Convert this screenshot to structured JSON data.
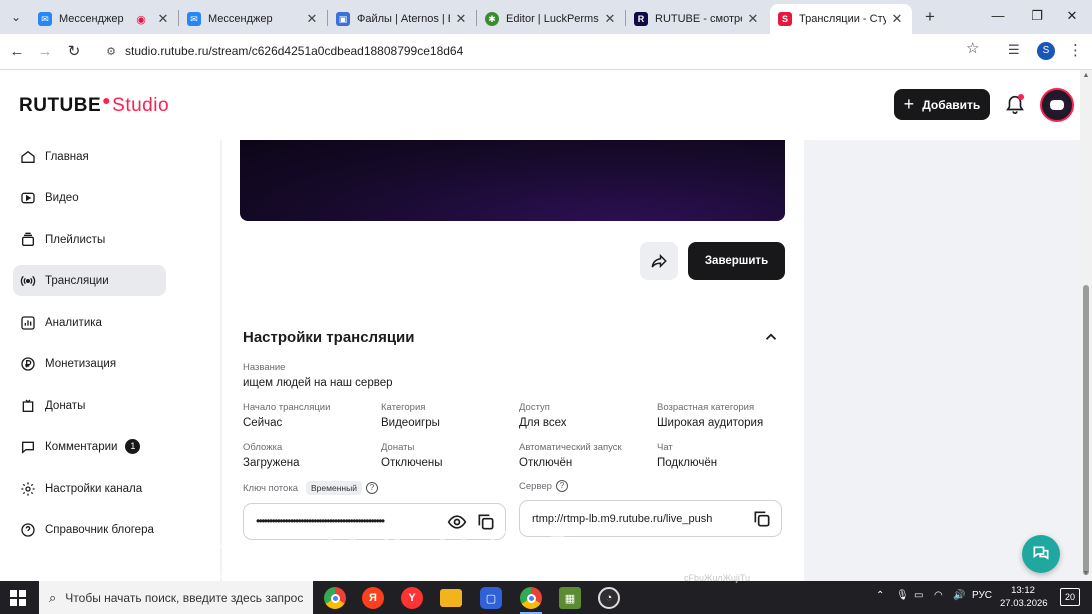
{
  "browser": {
    "tabs": [
      {
        "title": "Мессенджер",
        "favicon": "vk-messenger-icon",
        "color": "#2787f5"
      },
      {
        "title": "Мессенджер",
        "favicon": "vk-messenger-icon",
        "color": "#2787f5"
      },
      {
        "title": "Файлы | Aternos | Бе",
        "favicon": "aternos-icon",
        "color": "#3b6fd9"
      },
      {
        "title": "Editor | LuckPerms",
        "favicon": "luckperms-icon",
        "color": "#3d8a2e"
      },
      {
        "title": "RUTUBE - смотреть в",
        "favicon": "rutube-icon",
        "color": "#100943"
      },
      {
        "title": "Трансляции - Студия",
        "favicon": "rutube-studio-icon",
        "color": "#e8173d"
      }
    ],
    "url": "studio.rutube.ru/stream/c626d4251a0cdbead18808799ce18d64",
    "profile_initial": "S"
  },
  "header": {
    "logo_main": "RUTUBE",
    "logo_studio": "Studio",
    "add_label": "Добавить"
  },
  "sidebar": {
    "items": [
      {
        "label": "Главная",
        "icon": "home-icon"
      },
      {
        "label": "Видео",
        "icon": "video-icon"
      },
      {
        "label": "Плейлисты",
        "icon": "playlist-icon"
      },
      {
        "label": "Трансляции",
        "icon": "broadcast-icon",
        "active": true
      },
      {
        "label": "Аналитика",
        "icon": "analytics-icon"
      },
      {
        "label": "Монетизация",
        "icon": "ruble-icon"
      },
      {
        "label": "Донаты",
        "icon": "donate-icon"
      },
      {
        "label": "Комментарии",
        "icon": "comment-icon",
        "badge": "1"
      },
      {
        "label": "Настройки канала",
        "icon": "gear-icon"
      },
      {
        "label": "Справочник блогера",
        "icon": "help-circle-icon"
      }
    ]
  },
  "stream": {
    "end_label": "Завершить",
    "settings_title": "Настройки трансляции",
    "name_label": "Название",
    "name_value": "ищем людей на наш сервер",
    "fields": [
      {
        "label": "Начало трансляции",
        "value": "Сейчас"
      },
      {
        "label": "Категория",
        "value": "Видеоигры"
      },
      {
        "label": "Доступ",
        "value": "Для всех"
      },
      {
        "label": "Возрастная категория",
        "value": "Широкая аудитория"
      },
      {
        "label": "Обложка",
        "value": "Загружена"
      },
      {
        "label": "Донаты",
        "value": "Отключены"
      },
      {
        "label": "Автоматический запуск",
        "value": "Отключён"
      },
      {
        "label": "Чат",
        "value": "Подключён"
      }
    ],
    "key_label": "Ключ потока",
    "key_tag": "Временный",
    "key_masked": "•••••••••••••••••••••••••••••••••••••••••••••••••",
    "server_label": "Сервер",
    "server_value": "rtmp://rtmp-lb.m9.rutube.ru/live_push"
  },
  "overlay": {
    "watermark": "ski   :31621",
    "caption": "сFbuЖuлЖujiTu"
  },
  "taskbar": {
    "search_placeholder": "Чтобы начать поиск, введите здесь запрос",
    "language": "РУС",
    "time": "13:12",
    "date": "27.03.2026",
    "notifications": "20"
  },
  "colors": {
    "brand_red": "#ff1e50",
    "button_dark": "#18181b",
    "support_teal": "#1fa7a0"
  }
}
